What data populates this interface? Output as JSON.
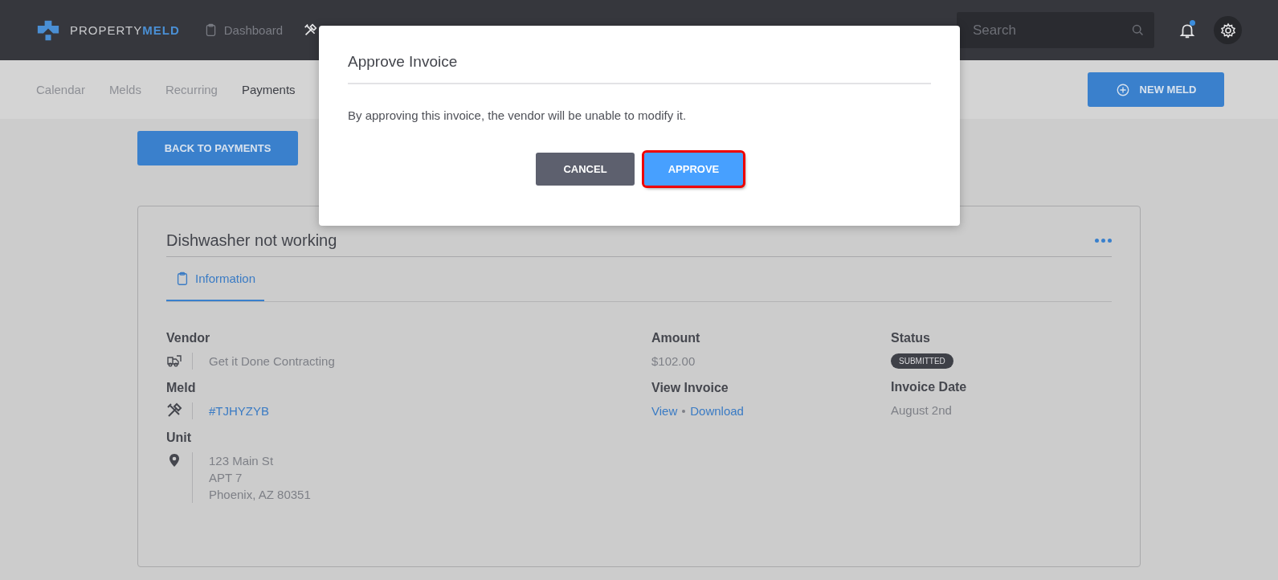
{
  "header": {
    "logo": {
      "part_1": "PROPERTY",
      "part_2": "MELD"
    },
    "nav": [
      {
        "label": "Dashboard",
        "selected": false
      }
    ],
    "search": {
      "placeholder": "Search"
    },
    "notifications": {
      "unread": true
    }
  },
  "subnav": {
    "tabs": [
      {
        "label": "Calendar",
        "selected": false
      },
      {
        "label": "Melds",
        "selected": false
      },
      {
        "label": "Recurring",
        "selected": false
      },
      {
        "label": "Payments",
        "selected": true
      }
    ],
    "new_button": "NEW MELD"
  },
  "back_button": "BACK TO PAYMENTS",
  "invoice": {
    "title": "Dishwasher not working",
    "tabs": [
      {
        "label": "Information",
        "selected": true
      }
    ],
    "columns": [
      [
        {
          "label": "Vendor",
          "kind": "text",
          "lines": [
            "Get it Done Contracting"
          ]
        },
        {
          "label": "Meld",
          "kind": "link",
          "lines": [
            "#TJHYZYB"
          ]
        },
        {
          "label": "Unit",
          "kind": "text",
          "lines": [
            "123 Main St",
            "APT 7",
            "Phoenix, AZ 80351"
          ]
        }
      ],
      [
        {
          "label": "Amount",
          "kind": "plain",
          "lines": [
            "$102.00"
          ]
        },
        {
          "label": "View Invoice",
          "kind": "links",
          "lines": [
            "View",
            "Download"
          ]
        }
      ],
      [
        {
          "label": "Status",
          "kind": "badge",
          "lines": [
            "SUBMITTED"
          ]
        },
        {
          "label": "Invoice Date",
          "kind": "plain",
          "lines": [
            "August 2nd"
          ]
        }
      ]
    ]
  },
  "dialog": {
    "title": "Approve Invoice",
    "message": "By approving this invoice, the vendor will be unable to modify it.",
    "buttons": [
      {
        "label": "CANCEL",
        "kind": "secondary",
        "highlighted": false
      },
      {
        "label": "APPROVE",
        "kind": "primary",
        "highlighted": true
      }
    ]
  }
}
